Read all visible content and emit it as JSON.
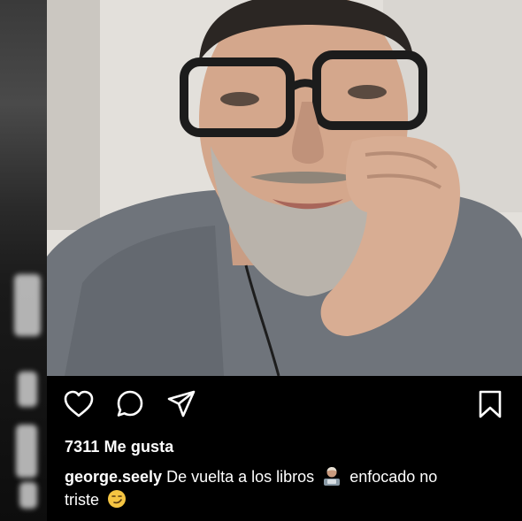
{
  "post": {
    "likes_count": "7311",
    "likes_label": "Me gusta",
    "username": "george.seely",
    "caption_part1": "De vuelta a los libros",
    "caption_part2": "enfocado no",
    "caption_part3": "triste",
    "emoji_1": "man-technologist-emoji",
    "emoji_2": "smirking-face-emoji"
  },
  "icons": {
    "like": "heart-icon",
    "comment": "comment-icon",
    "share": "send-icon",
    "save": "bookmark-icon"
  },
  "colors": {
    "background": "#000000",
    "text": "#ffffff",
    "icon_stroke": "#ffffff"
  }
}
